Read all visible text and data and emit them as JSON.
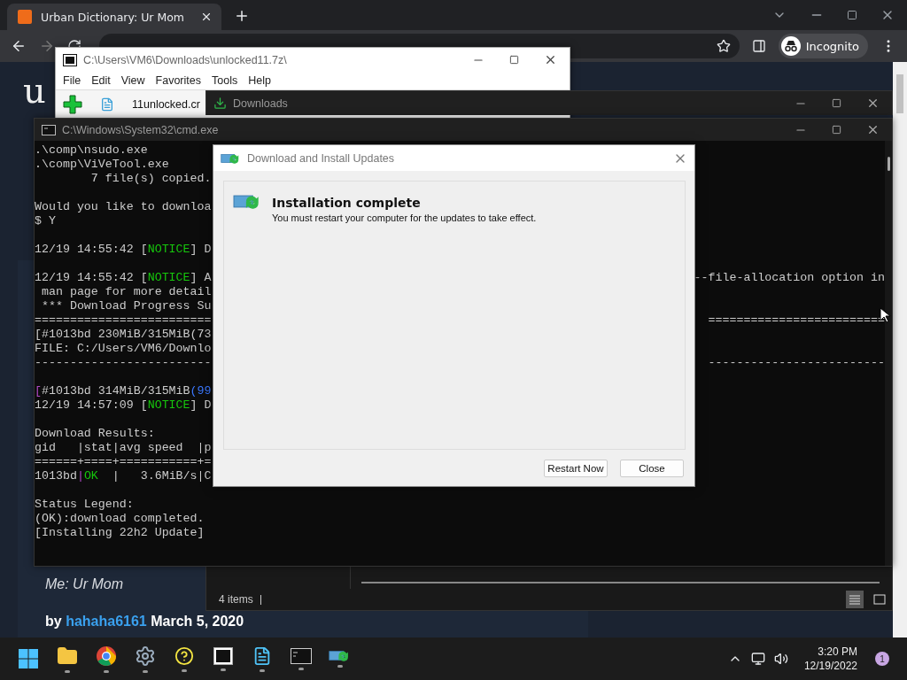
{
  "browser": {
    "tab": {
      "title": "Urban Dictionary: Ur Mom"
    },
    "profile": "Incognito",
    "page": {
      "logo_text": "u",
      "quote": "Me: Ur Mom",
      "byline": {
        "prefix": "by",
        "author": "hahaha6161",
        "date": "March 5, 2020"
      }
    }
  },
  "archive_window": {
    "title": "C:\\Users\\VM6\\Downloads\\unlocked11.7z\\",
    "menu": [
      "File",
      "Edit",
      "View",
      "Favorites",
      "Tools",
      "Help"
    ],
    "file": "11unlocked.cr"
  },
  "downloads_window": {
    "title": "Downloads",
    "status": "4 items"
  },
  "console_window": {
    "title": "C:\\Windows\\System32\\cmd.exe",
    "blocks": [
      [
        {
          "text": ".\\comp\\nsudo.exe"
        },
        {
          "text": ".\\comp\\ViVeTool.exe"
        },
        {
          "text": "        7 file(s) copied."
        }
      ],
      [
        {
          "text": "Would you like to downloa"
        },
        {
          "text": "$ Y"
        }
      ],
      [
        {
          "parts": [
            {
              "text": "12/19 14:55:42 [",
              "kind": "plain"
            },
            {
              "text": "NOTICE",
              "kind": "notice"
            },
            {
              "text": "] D",
              "kind": "plain"
            }
          ]
        }
      ],
      [
        {
          "parts": [
            {
              "text": "12/19 14:55:42 [",
              "kind": "plain"
            },
            {
              "text": "NOTICE",
              "kind": "notice"
            },
            {
              "text": "] A",
              "kind": "plain"
            }
          ],
          "right": "--file-allocation option in"
        },
        {
          "text": " man page for more detail"
        },
        {
          "text": " *** Download Progress Su"
        },
        {
          "text": "=========================",
          "right": "========================="
        },
        {
          "text": "[#1013bd 230MiB/315MiB(73"
        },
        {
          "text": "FILE: C:/Users/VM6/Downlo"
        },
        {
          "text": "-------------------------",
          "right": "-------------------------"
        }
      ],
      [
        {
          "parts": [
            {
              "text": "[",
              "kind": "accent"
            },
            {
              "text": "#1013bd 314MiB/315MiB",
              "kind": "plain"
            },
            {
              "text": "(99",
              "kind": "info"
            }
          ]
        },
        {
          "parts": [
            {
              "text": "12/19 14:57:09 [",
              "kind": "plain"
            },
            {
              "text": "NOTICE",
              "kind": "notice"
            },
            {
              "text": "] D",
              "kind": "plain"
            }
          ]
        }
      ],
      [
        {
          "text": "Download Results:"
        },
        {
          "text": "gid   |stat|avg speed  |p"
        },
        {
          "text": "======+====+===========+="
        },
        {
          "parts": [
            {
              "text": "1013bd",
              "kind": "plain"
            },
            {
              "text": "|",
              "kind": "accent"
            },
            {
              "text": "OK",
              "kind": "ok"
            },
            {
              "text": "  |   3.6MiB/s|C",
              "kind": "plain"
            }
          ]
        }
      ],
      [
        {
          "text": "Status Legend:"
        },
        {
          "text": "(OK):download completed."
        },
        {
          "text": "[Installing 22h2 Update]"
        }
      ]
    ]
  },
  "update_dialog": {
    "title": "Download and Install Updates",
    "heading": "Installation complete",
    "message": "You must restart your computer for the updates to take effect.",
    "buttons": [
      "Restart Now",
      "Close"
    ]
  },
  "taskbar": {
    "time": "3:20 PM",
    "date": "12/19/2022",
    "notifications": "1"
  }
}
